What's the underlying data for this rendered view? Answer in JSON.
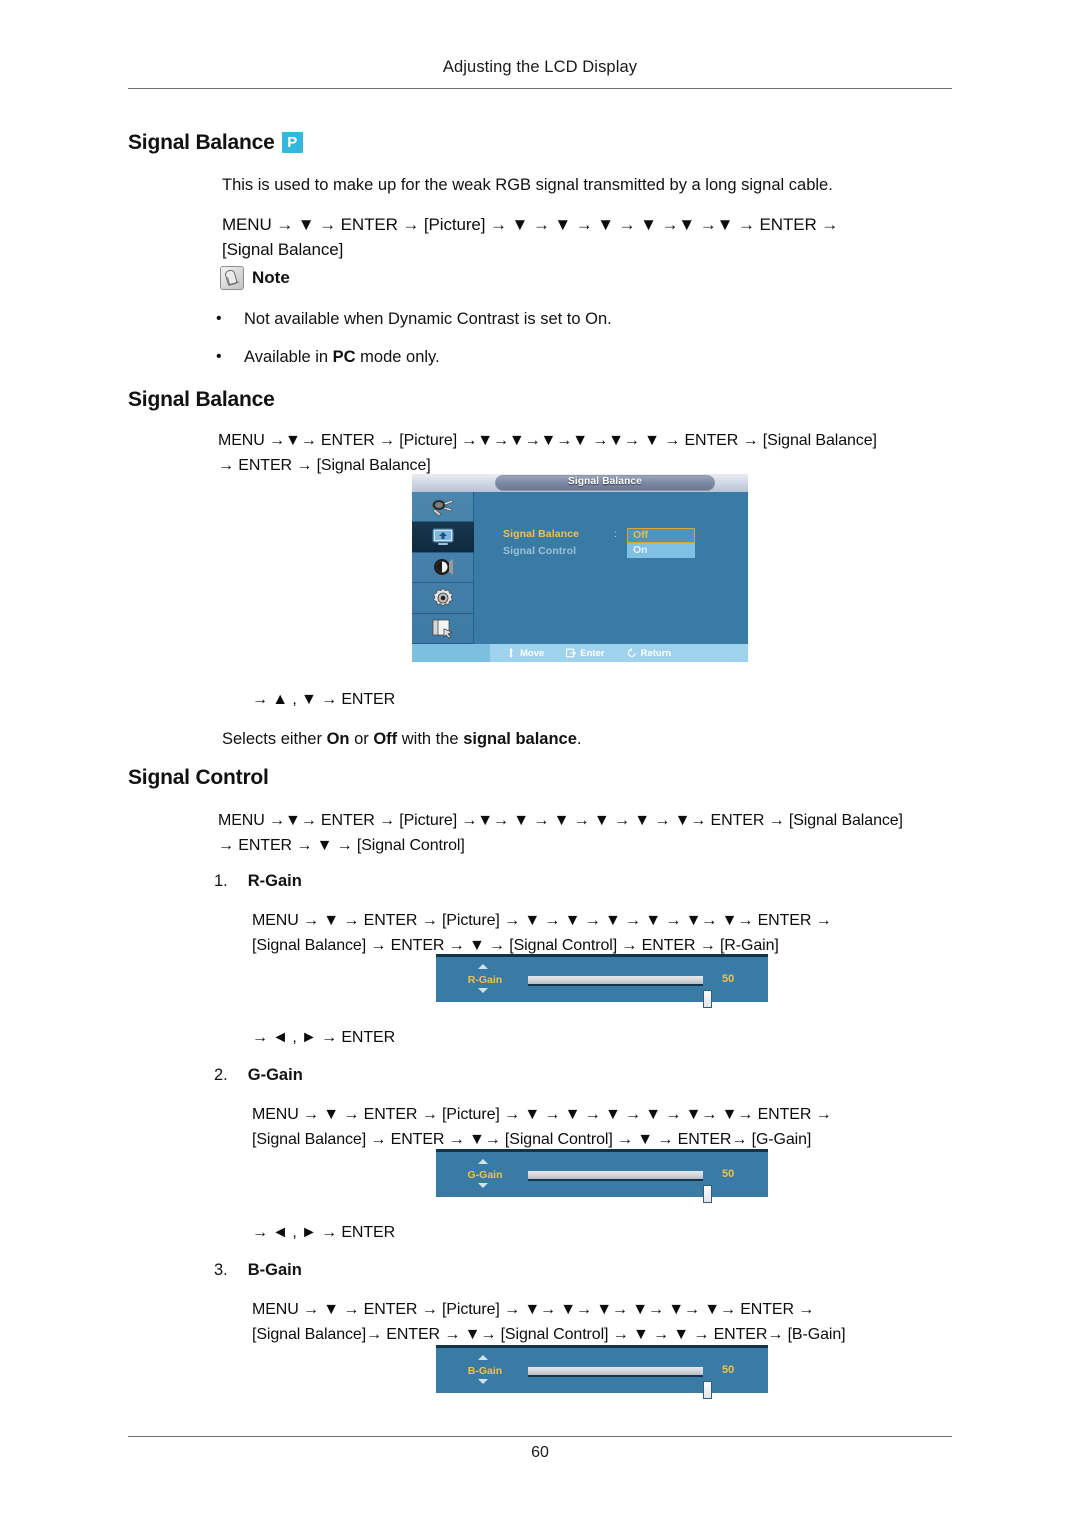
{
  "document": {
    "header_title": "Adjusting the LCD Display",
    "page_number": "60"
  },
  "sections": [
    {
      "id": "signal-balance-overview",
      "heading": "Signal Balance",
      "badge": "P",
      "description": "This is used to make up for the weak RGB signal transmitted by a long signal cable.",
      "path_line1": "MENU  →  ▼  →  ENTER  →  [Picture]  →  ▼  →  ▼  →  ▼  →  ▼  →▼  →▼  →  ENTER  →",
      "path_line2": "[Signal Balance]",
      "note_label": "Note",
      "notes": [
        "Not available when Dynamic Contrast is set to On.",
        "Available in PC mode only."
      ]
    },
    {
      "id": "signal-balance",
      "heading": "Signal Balance",
      "path_line1": "MENU →▼→ ENTER → [Picture] →▼→▼→▼→▼ →▼→ ▼ → ENTER → [Signal Balance]",
      "path_line2": "→ ENTER → [Signal Balance]",
      "after_path": "→ ▲ , ▼ → ENTER",
      "description": "Selects either On or Off with the signal balance."
    },
    {
      "id": "signal-control",
      "heading": "Signal Control",
      "path_line1": "MENU →▼→ ENTER → [Picture] →▼→ ▼ → ▼ → ▼ → ▼ → ▼→ ENTER → [Signal Balance]",
      "path_line2": "→ ENTER → ▼ → [Signal Control]"
    }
  ],
  "gain_items": [
    {
      "number": "1.",
      "title": "R-Gain",
      "path_line1": "MENU  →  ▼  →  ENTER  →  [Picture]  →  ▼  →  ▼  →  ▼  →  ▼  →  ▼→  ▼→  ENTER  →",
      "path_line2": "[Signal Balance] → ENTER → ▼ → [Signal Control] → ENTER → [R-Gain]",
      "after_path": "→ ◄ , ► → ENTER",
      "osd": {
        "label": "R-Gain",
        "value": "50"
      }
    },
    {
      "number": "2.",
      "title": "G-Gain",
      "path_line1": "MENU  →  ▼  →  ENTER  →  [Picture]  →  ▼  →  ▼  →  ▼  →  ▼  →  ▼→  ▼→  ENTER  →",
      "path_line2": "[Signal Balance] → ENTER → ▼→ [Signal Control] → ▼ → ENTER→ [G-Gain]",
      "after_path": "→ ◄ , ► → ENTER",
      "osd": {
        "label": "G-Gain",
        "value": "50"
      }
    },
    {
      "number": "3.",
      "title": "B-Gain",
      "path_line1": "MENU  →  ▼  →  ENTER  →  [Picture]  →  ▼→  ▼→  ▼→  ▼→  ▼→  ▼→  ENTER  →",
      "path_line2": "[Signal Balance]→ ENTER → ▼→ [Signal Control] → ▼ → ▼ → ENTER→ [B-Gain]",
      "osd": {
        "label": "B-Gain",
        "value": "50"
      }
    }
  ],
  "osd_menu": {
    "title": "Signal Balance",
    "rows": [
      {
        "label": "Signal Balance",
        "state": "active"
      },
      {
        "label": "Signal Control",
        "state": "dim"
      }
    ],
    "options": [
      {
        "label": "Off",
        "selected": true
      },
      {
        "label": "On",
        "selected": false
      }
    ],
    "sidebar_icons": [
      "input-source-icon",
      "picture-icon",
      "sound-icon",
      "setup-gear-icon",
      "multi-control-icon"
    ],
    "footer_hints": [
      {
        "icon": "move-icon",
        "label": "Move"
      },
      {
        "icon": "enter-icon",
        "label": "Enter"
      },
      {
        "icon": "return-icon",
        "label": "Return"
      }
    ]
  },
  "colors": {
    "osd_background": "#3a7ba5",
    "osd_highlight_border": "#d2a93a",
    "osd_label_active": "#f2c14a",
    "badge_background": "#33b7dd",
    "osd_footer_bar": "#9fd2ec"
  }
}
